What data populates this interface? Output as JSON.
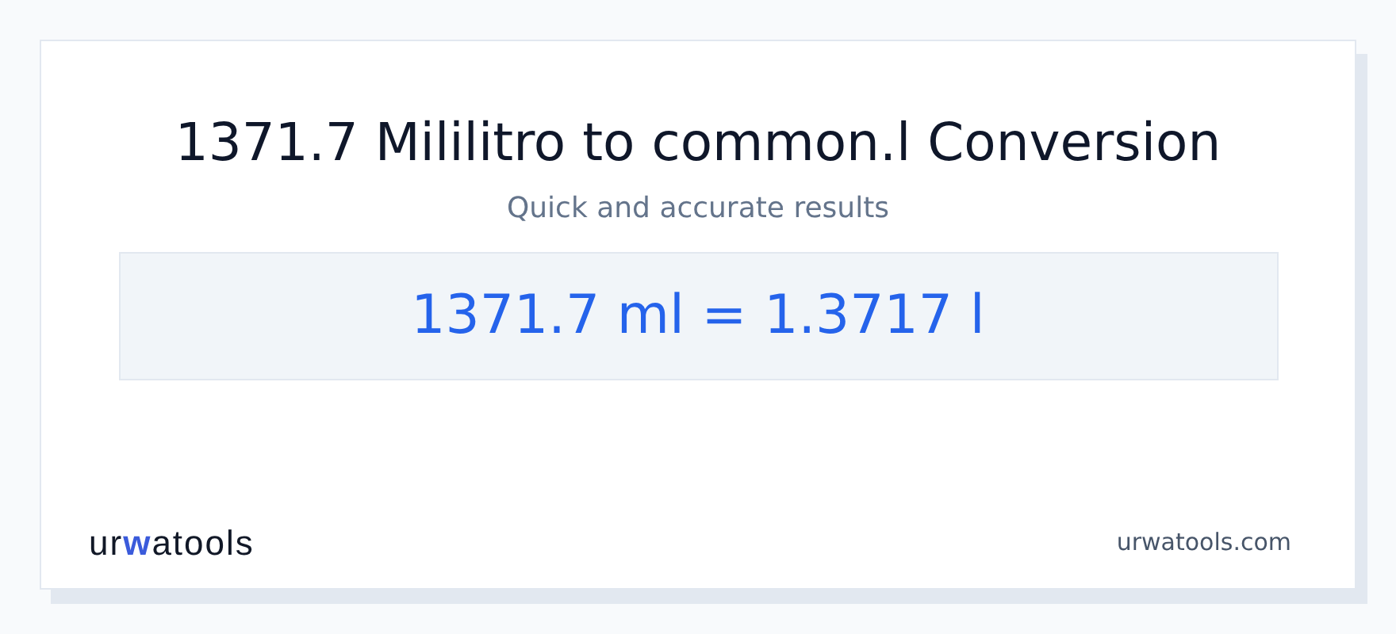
{
  "title": "1371.7 Mililitro to common.l Conversion",
  "subtitle": "Quick and accurate results",
  "result": "1371.7 ml = 1.3717 l",
  "footer": {
    "logo": "urwatools",
    "site": "urwatools.com"
  }
}
